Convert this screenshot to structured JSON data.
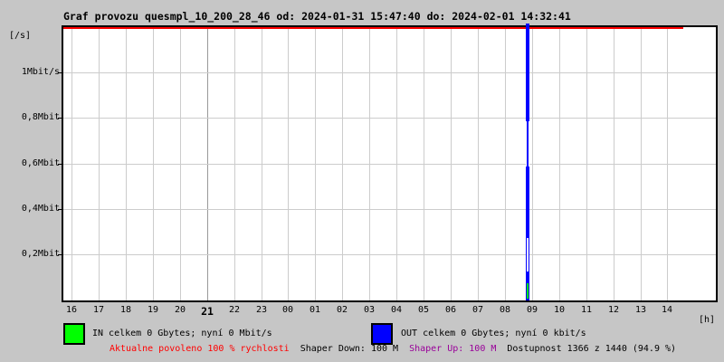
{
  "title": "Graf provozu quesmpl_10_200_28_46 od: 2024-01-31 15:47:40 do: 2024-02-01 14:32:41",
  "y_axis": {
    "unit": "[/s]",
    "tick_labels": [
      "1Mbit/s",
      "0,8Mbit",
      "0,6Mbit",
      "0,4Mbit",
      "0,2Mbit"
    ]
  },
  "x_axis": {
    "unit": "[h]",
    "tick_labels": [
      "16",
      "17",
      "18",
      "19",
      "20",
      "21",
      "22",
      "23",
      "00",
      "01",
      "02",
      "03",
      "04",
      "05",
      "06",
      "07",
      "08",
      "09",
      "10",
      "11",
      "12",
      "13",
      "14"
    ],
    "bold_tick": "21"
  },
  "legend": [
    {
      "series": "in",
      "swatch_color": "#00ff00",
      "label": "IN celkem 0 Gbytes; nyní 0 Mbit/s"
    },
    {
      "series": "out",
      "swatch_color": "#0000ff",
      "label": "OUT celkem 0 Gbytes; nyní 0 kbit/s"
    }
  ],
  "status_line": [
    {
      "text": "Aktualne povoleno 100 % rychlosti",
      "color": "#ff0000"
    },
    {
      "text": "Shaper Down: 100 M",
      "color": "#000000"
    },
    {
      "text": "Shaper Up: 100 M",
      "color": "#990099"
    },
    {
      "text": "Dostupnost 1366 z 1440 (94.9 %)",
      "color": "#000000"
    }
  ],
  "colors": {
    "background": "#c6c6c6",
    "plot_background": "#ffffff",
    "grid": "#cccccc",
    "grid_emphasis": "#999999",
    "border": "#000000",
    "max_speed_line": "#ff0000",
    "in_series": "#00ff00",
    "out_series": "#0000ff"
  },
  "chart_data": {
    "type": "area",
    "title": "Graf provozu quesmpl_10_200_28_46 od: 2024-01-31 15:47:40 do: 2024-02-01 14:32:41",
    "xlabel": "[h]",
    "ylabel": "[/s]",
    "y_unit": "Mbit/s",
    "ylim": [
      0,
      1.2
    ],
    "grid": true,
    "categories": [
      "16",
      "17",
      "18",
      "19",
      "20",
      "21",
      "22",
      "23",
      "00",
      "01",
      "02",
      "03",
      "04",
      "05",
      "06",
      "07",
      "08",
      "09",
      "10",
      "11",
      "12",
      "13",
      "14"
    ],
    "series": [
      {
        "name": "IN",
        "color": "#00ff00",
        "total": "0 Gbytes",
        "current": "0 Mbit/s",
        "values": [
          0,
          0,
          0,
          0,
          0,
          0,
          0,
          0,
          0,
          0,
          0,
          0,
          0,
          0,
          0,
          0,
          0,
          0.07,
          0,
          0,
          0,
          0,
          0
        ]
      },
      {
        "name": "OUT",
        "color": "#0000ff",
        "total": "0 Gbytes",
        "current": "0 kbit/s",
        "values": [
          0,
          0,
          0,
          0,
          0,
          0,
          0,
          0,
          0,
          0,
          0,
          0,
          0,
          0,
          0,
          0,
          0,
          1.2,
          0,
          0,
          0,
          0,
          0
        ]
      }
    ],
    "spike": {
      "time_approx": "08:50",
      "out_peak": "full scale, >1.2 Mbit/s (clipped at plot top)",
      "in_peak": "~0.07 Mbit/s"
    },
    "red_line_note": "red maximum-speed line along top of scale, drawn from start time to current time 14:32"
  }
}
